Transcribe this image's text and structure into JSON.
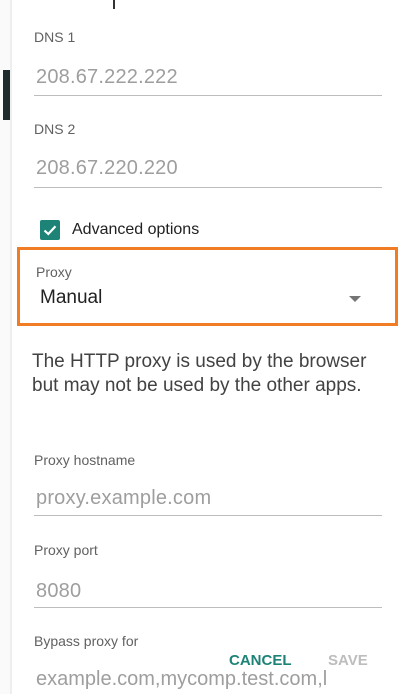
{
  "dns1": {
    "label": "DNS 1",
    "value": "208.67.222.222"
  },
  "dns2": {
    "label": "DNS 2",
    "value": "208.67.220.220"
  },
  "advanced_options": {
    "label": "Advanced options",
    "checked": true
  },
  "proxy": {
    "label": "Proxy",
    "value": "Manual"
  },
  "help_text": "The HTTP proxy is used by the browser but may not be used by the other apps.",
  "proxy_hostname": {
    "label": "Proxy hostname",
    "placeholder": "proxy.example.com"
  },
  "proxy_port": {
    "label": "Proxy port",
    "placeholder": "8080"
  },
  "bypass_proxy": {
    "label": "Bypass proxy for",
    "placeholder": "example.com,mycomp.test.com,l"
  },
  "actions": {
    "cancel": "CANCEL",
    "save": "SAVE"
  },
  "colors": {
    "accent": "#1e8377",
    "highlight": "#f07c26"
  }
}
